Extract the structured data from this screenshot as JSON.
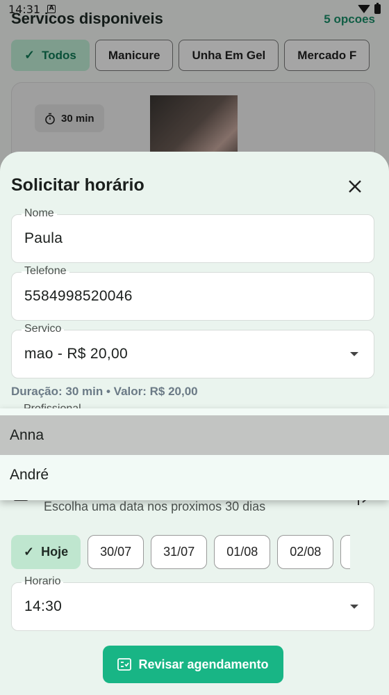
{
  "status_bar": {
    "time": "14:31",
    "notification_icon": "A"
  },
  "background": {
    "title": "Servicos disponiveis",
    "count": "5 opcoes",
    "filters": [
      {
        "label": "Todos",
        "selected": true
      },
      {
        "label": "Manicure",
        "selected": false
      },
      {
        "label": "Unha Em Gel",
        "selected": false
      },
      {
        "label": "Mercado F",
        "selected": false
      }
    ],
    "card": {
      "duration": "30 min"
    }
  },
  "sheet": {
    "title": "Solicitar horário",
    "fields": {
      "name": {
        "label": "Nome",
        "value": "Paula"
      },
      "phone": {
        "label": "Telefone",
        "value": "5584998520046"
      },
      "service": {
        "label": "Servico",
        "value": "mao - R$ 20,00"
      },
      "time": {
        "label": "Horario",
        "value": "14:30"
      }
    },
    "service_info": "Duração: 30 min • Valor: R$ 20,00",
    "professional_label": "Profissional",
    "date_hint": "Escolha uma data nos proximos 30 dias",
    "dates": [
      {
        "label": "Hoje",
        "selected": true
      },
      {
        "label": "30/07",
        "selected": false
      },
      {
        "label": "31/07",
        "selected": false
      },
      {
        "label": "01/08",
        "selected": false
      },
      {
        "label": "02/08",
        "selected": false
      }
    ],
    "review_button": "Revisar agendamento"
  },
  "dropdown": {
    "options": [
      {
        "label": "Anna",
        "highlighted": true
      },
      {
        "label": "André",
        "highlighted": false
      }
    ]
  },
  "colors": {
    "accent": "#18b585",
    "sheet_bg": "#eaf4ee",
    "chip_selected": "#bfe6cf"
  }
}
